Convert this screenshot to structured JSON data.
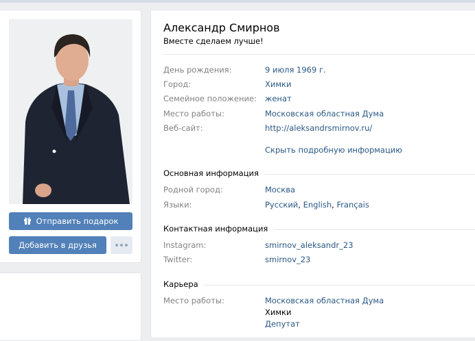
{
  "profile": {
    "name": "Александр Смирнов",
    "status": "Вместе сделаем лучше!"
  },
  "actions": {
    "gift_label": "Отправить подарок",
    "add_friend_label": "Добавить в друзья",
    "gift_icon": "gift-icon",
    "more_icon": "more-dots-icon"
  },
  "info": {
    "birthday": {
      "label": "День рождения:",
      "value": "9 июля 1969 г."
    },
    "city": {
      "label": "Город:",
      "value": "Химки"
    },
    "family": {
      "label": "Семейное положение:",
      "value": "женат"
    },
    "work": {
      "label": "Место работы:",
      "value": "Московская областная Дума"
    },
    "website": {
      "label": "Веб-сайт:",
      "value": "http://aleksandrsmirnov.ru/"
    },
    "hide_details": "Скрыть подробную информацию"
  },
  "basic": {
    "title": "Основная информация",
    "hometown": {
      "label": "Родной город:",
      "value": "Москва"
    },
    "languages": {
      "label": "Языки:",
      "values": [
        "Русский",
        "English",
        "Français"
      ],
      "separator": ", "
    }
  },
  "contacts": {
    "title": "Контактная информация",
    "instagram": {
      "label": "Instagram:",
      "value": "smirnov_aleksandr_23"
    },
    "twitter": {
      "label": "Twitter:",
      "value": "smirnov_23"
    }
  },
  "career": {
    "title": "Карьера",
    "label": "Место работы:",
    "org": "Московская областная Дума",
    "city": "Химки",
    "position": "Депутат"
  },
  "colors": {
    "link": "#2a5885",
    "button": "#5181b8",
    "label_gray": "#828282",
    "background": "#edeef0"
  }
}
